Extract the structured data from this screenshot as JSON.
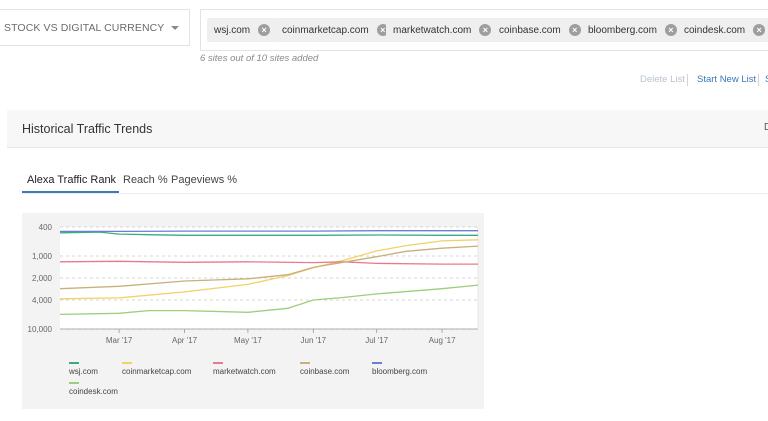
{
  "list_select": {
    "label": "STOCK VS DIGITAL CURRENCY"
  },
  "sites": [
    {
      "name": "wsj.com"
    },
    {
      "name": "coinmarketcap.com"
    },
    {
      "name": "marketwatch.com"
    },
    {
      "name": "coinbase.com"
    },
    {
      "name": "bloomberg.com"
    },
    {
      "name": "coindesk.com"
    }
  ],
  "sites_count": "6 sites out of 10 sites added",
  "actions": {
    "delete": "Delete List",
    "new": "Start New List",
    "more": "S"
  },
  "panel": {
    "title": "Historical Traffic Trends",
    "edge_text": "D"
  },
  "tabs": [
    {
      "label": "Alexa Traffic Rank",
      "active": true
    },
    {
      "label": "Reach %",
      "active": false
    },
    {
      "label": "Pageviews %",
      "active": false
    }
  ],
  "chart_data": {
    "type": "line",
    "title": "",
    "xlabel": "",
    "ylabel": "",
    "y_scale": "log",
    "y_inverted": true,
    "ylim": [
      400,
      10000
    ],
    "y_tick_labels": [
      {
        "value": 400,
        "label": "400"
      },
      {
        "value": 1000,
        "label": "1,000"
      },
      {
        "value": 2000,
        "label": "2,000"
      },
      {
        "value": 4000,
        "label": "4,000"
      },
      {
        "value": 10000,
        "label": "10,000"
      }
    ],
    "x_range": [
      "2017-02-01",
      "2017-08-18"
    ],
    "x_ticks": [
      {
        "date": "2017-03-01",
        "label": "Mar '17"
      },
      {
        "date": "2017-04-01",
        "label": "Apr '17"
      },
      {
        "date": "2017-05-01",
        "label": "May '17"
      },
      {
        "date": "2017-06-01",
        "label": "Jun '17"
      },
      {
        "date": "2017-07-01",
        "label": "Jul '17"
      },
      {
        "date": "2017-08-01",
        "label": "Aug '17"
      }
    ],
    "legend_position": "bottom",
    "series": [
      {
        "name": "wsj.com",
        "color": "#3aa987",
        "points": [
          [
            "2017-02-01",
            480
          ],
          [
            "2017-02-20",
            470
          ],
          [
            "2017-03-01",
            500
          ],
          [
            "2017-03-15",
            510
          ],
          [
            "2017-04-01",
            520
          ],
          [
            "2017-05-01",
            520
          ],
          [
            "2017-06-01",
            520
          ],
          [
            "2017-07-01",
            515
          ],
          [
            "2017-08-01",
            520
          ],
          [
            "2017-08-18",
            520
          ]
        ]
      },
      {
        "name": "coinmarketcap.com",
        "color": "#f2d165",
        "points": [
          [
            "2017-02-01",
            3850
          ],
          [
            "2017-03-01",
            3750
          ],
          [
            "2017-04-01",
            3100
          ],
          [
            "2017-05-01",
            2450
          ],
          [
            "2017-05-20",
            1850
          ],
          [
            "2017-06-01",
            1450
          ],
          [
            "2017-06-15",
            1150
          ],
          [
            "2017-07-01",
            850
          ],
          [
            "2017-07-15",
            720
          ],
          [
            "2017-08-01",
            620
          ],
          [
            "2017-08-18",
            600
          ]
        ]
      },
      {
        "name": "marketwatch.com",
        "color": "#e77a8c",
        "points": [
          [
            "2017-02-01",
            1200
          ],
          [
            "2017-03-01",
            1180
          ],
          [
            "2017-04-01",
            1220
          ],
          [
            "2017-05-01",
            1200
          ],
          [
            "2017-06-01",
            1230
          ],
          [
            "2017-06-15",
            1200
          ],
          [
            "2017-07-01",
            1260
          ],
          [
            "2017-08-01",
            1290
          ],
          [
            "2017-08-18",
            1290
          ]
        ]
      },
      {
        "name": "coinbase.com",
        "color": "#c8b07a",
        "points": [
          [
            "2017-02-01",
            2800
          ],
          [
            "2017-03-01",
            2600
          ],
          [
            "2017-04-01",
            2200
          ],
          [
            "2017-05-01",
            2050
          ],
          [
            "2017-05-20",
            1800
          ],
          [
            "2017-06-01",
            1430
          ],
          [
            "2017-06-15",
            1220
          ],
          [
            "2017-07-01",
            1020
          ],
          [
            "2017-07-15",
            860
          ],
          [
            "2017-08-01",
            780
          ],
          [
            "2017-08-18",
            730
          ]
        ]
      },
      {
        "name": "bloomberg.com",
        "color": "#6a7fd1",
        "points": [
          [
            "2017-02-01",
            460
          ],
          [
            "2017-03-01",
            460
          ],
          [
            "2017-04-01",
            455
          ],
          [
            "2017-05-01",
            455
          ],
          [
            "2017-06-01",
            455
          ],
          [
            "2017-07-01",
            450
          ],
          [
            "2017-08-01",
            450
          ],
          [
            "2017-08-18",
            450
          ]
        ]
      },
      {
        "name": "coindesk.com",
        "color": "#9ccf7a",
        "points": [
          [
            "2017-02-01",
            6300
          ],
          [
            "2017-03-01",
            6100
          ],
          [
            "2017-03-15",
            5600
          ],
          [
            "2017-04-01",
            5600
          ],
          [
            "2017-05-01",
            5900
          ],
          [
            "2017-05-20",
            5200
          ],
          [
            "2017-06-01",
            4000
          ],
          [
            "2017-06-15",
            3700
          ],
          [
            "2017-07-01",
            3300
          ],
          [
            "2017-08-01",
            2800
          ],
          [
            "2017-08-18",
            2500
          ]
        ]
      }
    ]
  }
}
